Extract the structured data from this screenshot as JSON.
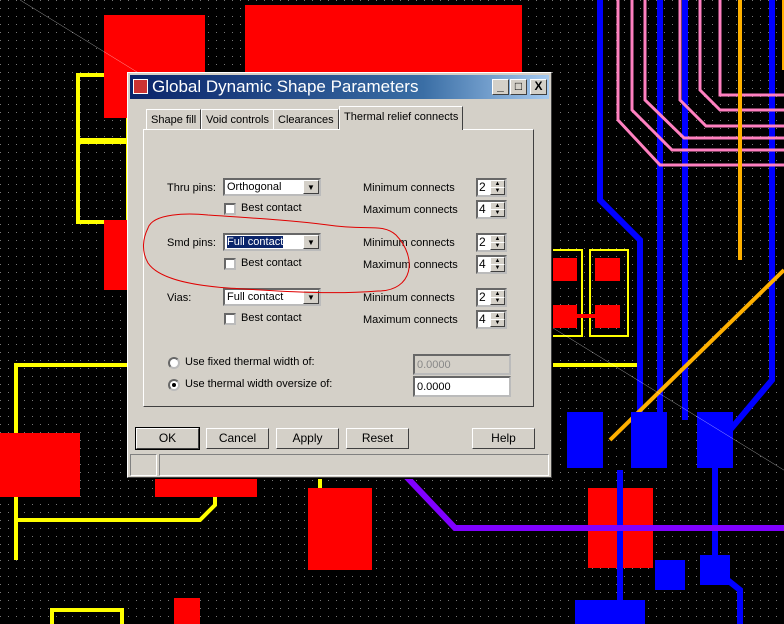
{
  "dialog": {
    "title": "Global Dynamic Shape Parameters",
    "window_buttons": {
      "minimize": "_",
      "maximize": "□",
      "close": "X"
    },
    "tabs": [
      {
        "label": "Shape fill"
      },
      {
        "label": "Void controls"
      },
      {
        "label": "Clearances"
      },
      {
        "label": "Thermal relief connects",
        "active": true
      }
    ],
    "rows": [
      {
        "label": "Thru pins:",
        "value": "Orthogonal",
        "best_contact": "Best contact",
        "min_label": "Minimum connects",
        "min": "2",
        "max_label": "Maximum connects",
        "max": "4"
      },
      {
        "label": "Smd pins:",
        "value": "Full contact",
        "best_contact": "Best contact",
        "min_label": "Minimum connects",
        "min": "2",
        "max_label": "Maximum connects",
        "max": "4"
      },
      {
        "label": "Vias:",
        "value": "Full contact",
        "best_contact": "Best contact",
        "min_label": "Minimum connects",
        "min": "2",
        "max_label": "Maximum connects",
        "max": "4"
      }
    ],
    "fixed_width": {
      "label": "Use fixed thermal width of:",
      "value": "0.0000",
      "selected": false
    },
    "oversize_width": {
      "label": "Use thermal width oversize of:",
      "value": "0.0000",
      "selected": true
    },
    "buttons": {
      "ok": "OK",
      "cancel": "Cancel",
      "apply": "Apply",
      "reset": "Reset",
      "help": "Help"
    }
  },
  "colors": {
    "pad": "#ff0000",
    "outline": "#ffff00",
    "trace_blue": "#0000ff",
    "trace_pink": "#ff80c0",
    "trace_orange": "#ffb000",
    "trace_purple": "#8000ff",
    "annotation": "#e00000"
  }
}
